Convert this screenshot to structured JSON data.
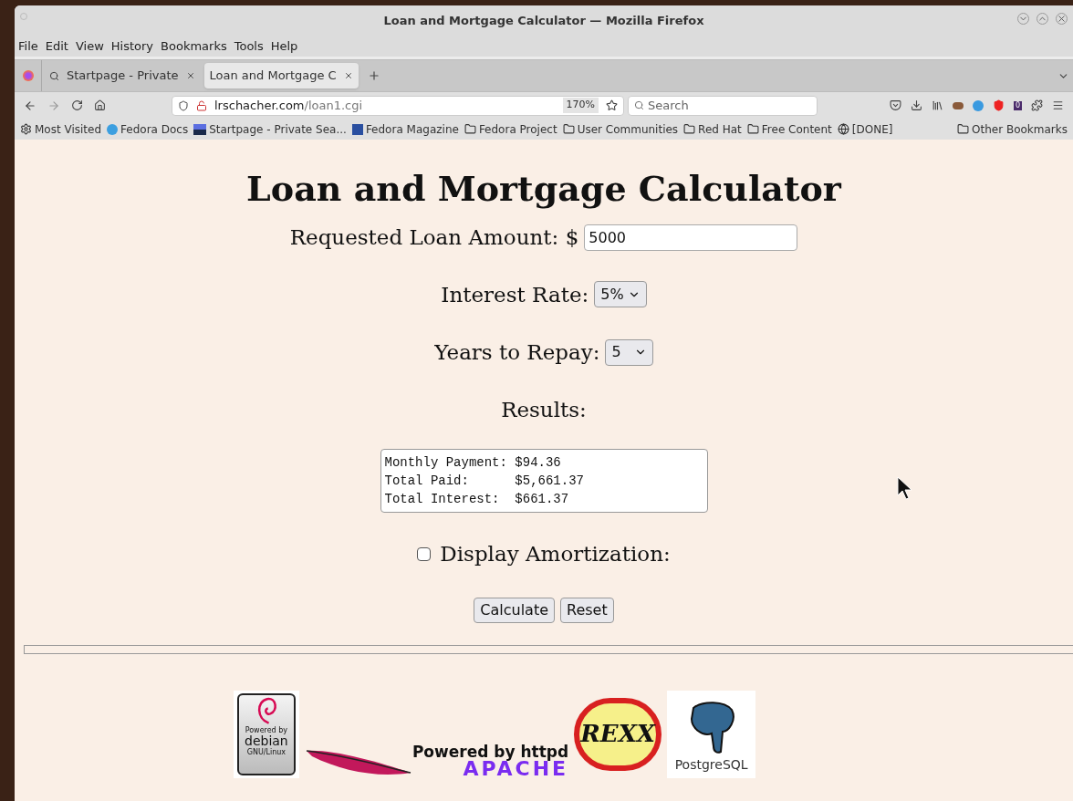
{
  "window": {
    "title": "Loan and Mortgage Calculator — Mozilla Firefox"
  },
  "menu": [
    "File",
    "Edit",
    "View",
    "History",
    "Bookmarks",
    "Tools",
    "Help"
  ],
  "tabs": [
    {
      "label": "Startpage - Private",
      "selected": false
    },
    {
      "label": "Loan and Mortgage C",
      "selected": true
    }
  ],
  "address": {
    "domain": "lrschacher.com",
    "path": "/loan1.cgi",
    "zoom": "170%"
  },
  "search": {
    "placeholder": "Search"
  },
  "toolbar_badge": "0",
  "bookmarks": [
    {
      "label": "Most Visited",
      "kind": "gear"
    },
    {
      "label": "Fedora Docs",
      "kind": "fedora"
    },
    {
      "label": "Startpage - Private Sea...",
      "kind": "startpage"
    },
    {
      "label": "Fedora Magazine",
      "kind": "magazine"
    },
    {
      "label": "Fedora Project",
      "kind": "folder"
    },
    {
      "label": "User Communities",
      "kind": "folder"
    },
    {
      "label": "Red Hat",
      "kind": "folder"
    },
    {
      "label": "Free Content",
      "kind": "folder"
    },
    {
      "label": "[DONE]",
      "kind": "globe"
    }
  ],
  "other_bookmarks": "Other Bookmarks",
  "page": {
    "heading": "Loan and Mortgage Calculator",
    "loan": {
      "label": "Requested Loan Amount: $",
      "value": "5000"
    },
    "rate": {
      "label": "Interest Rate:",
      "value": "5%"
    },
    "years": {
      "label": "Years to Repay:",
      "value": "5"
    },
    "results_label": "Results:",
    "results": [
      "Monthly Payment: $94.36",
      "Total Paid:      $5,661.37",
      "Total Interest:  $661.37"
    ],
    "amortization": {
      "label": "Display Amortization:",
      "checked": false
    },
    "buttons": [
      "Calculate",
      "Reset"
    ]
  },
  "logos": {
    "debian": [
      "Powered by",
      "debian",
      "GNU/Linux"
    ],
    "apache": [
      "Powered by httpd",
      "APACHE"
    ],
    "rexx": "REXX",
    "postgres": "PostgreSQL"
  }
}
